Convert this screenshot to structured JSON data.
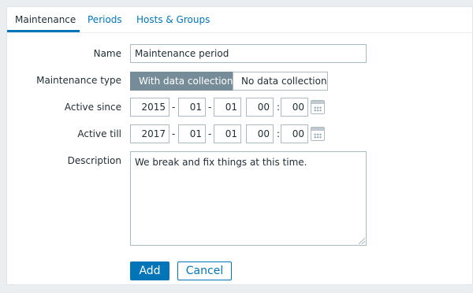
{
  "tabs": [
    {
      "label": "Maintenance",
      "active": true
    },
    {
      "label": "Periods",
      "active": false
    },
    {
      "label": "Hosts & Groups",
      "active": false
    }
  ],
  "form": {
    "name": {
      "label": "Name",
      "value": "Maintenance period"
    },
    "maintenance_type": {
      "label": "Maintenance type",
      "options": [
        "With data collection",
        "No data collection"
      ],
      "selected": "With data collection"
    },
    "active_since": {
      "label": "Active since",
      "year": "2015",
      "month": "01",
      "day": "01",
      "hour": "00",
      "minute": "00"
    },
    "active_till": {
      "label": "Active till",
      "year": "2017",
      "month": "01",
      "day": "01",
      "hour": "00",
      "minute": "00"
    },
    "description": {
      "label": "Description",
      "value": "We break and fix things at this time."
    },
    "date_sep": "-",
    "time_sep": ":"
  },
  "buttons": {
    "add": "Add",
    "cancel": "Cancel"
  },
  "colors": {
    "accent": "#0275b8",
    "segment_selected": "#768d99",
    "background": "#ebeef0"
  }
}
